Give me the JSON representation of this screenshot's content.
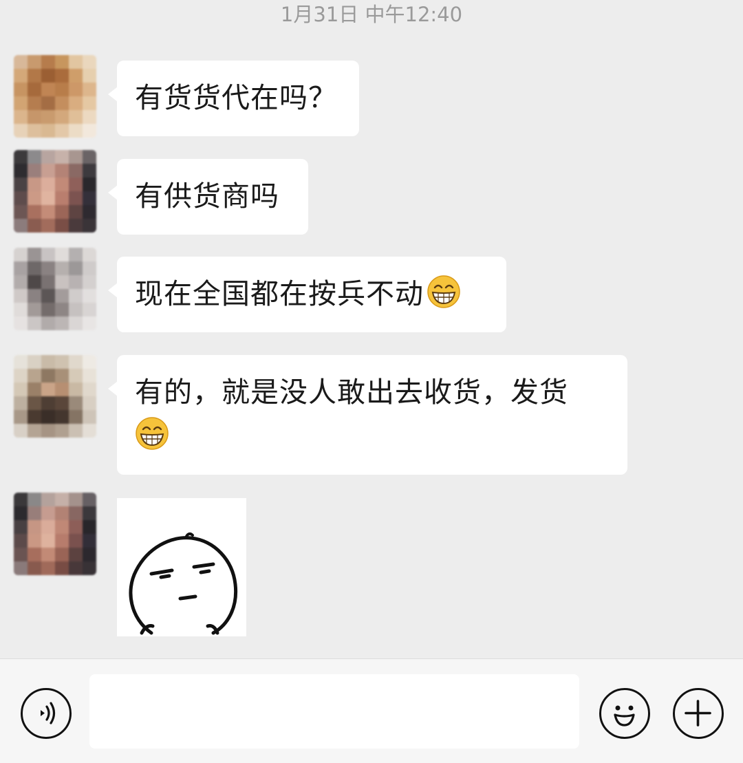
{
  "chat": {
    "timestamp": "1月31日 中午12:40",
    "messages": [
      {
        "type": "text",
        "text": "有货货代在吗？"
      },
      {
        "type": "text",
        "text": "有供货商吗"
      },
      {
        "type": "text",
        "text": "现在全国都在按兵不动",
        "emoji": "grinning-face-emoji"
      },
      {
        "type": "text",
        "text": "有的，就是没人敢出去收货，发货",
        "emoji": "grinning-face-emoji"
      },
      {
        "type": "sticker",
        "sticker": "doodle-face-sticker"
      }
    ]
  },
  "input_bar": {
    "voice_icon": "voice-icon",
    "text_value": "",
    "emoji_icon": "emoji-icon",
    "plus_icon": "plus-icon"
  }
}
